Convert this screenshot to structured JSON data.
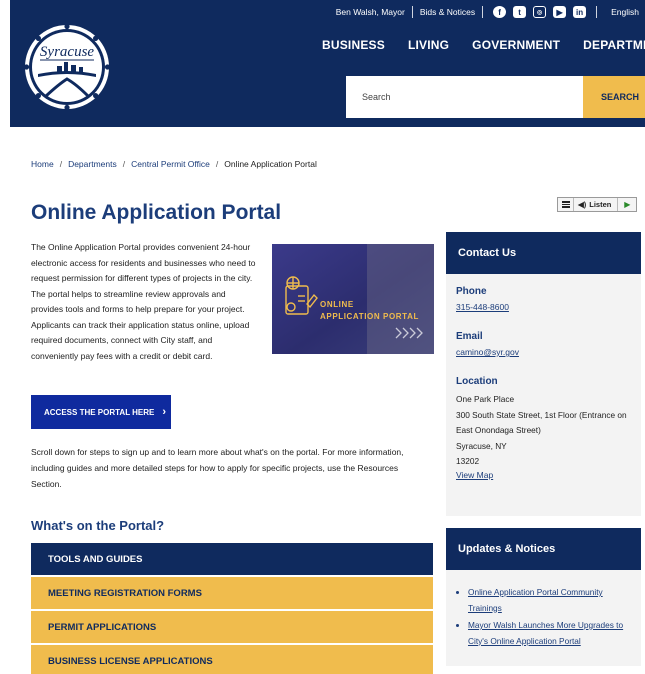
{
  "colors": {
    "navy": "#0f2a5e",
    "gold": "#f0bc4d",
    "link_blue": "#1c3d7a",
    "cta_blue": "#0f2a9e",
    "sidebar_bg": "#f3f3f3"
  },
  "header": {
    "logo_text": "Syracuse",
    "mayor_link": "Ben Walsh, Mayor",
    "bids_link": "Bids & Notices",
    "social_icons": [
      "facebook-icon",
      "twitter-icon",
      "instagram-icon",
      "youtube-icon",
      "linkedin-icon"
    ],
    "language": "English",
    "nav": [
      "BUSINESS",
      "LIVING",
      "GOVERNMENT",
      "DEPARTMENTS"
    ],
    "search_placeholder": "Search",
    "search_button": "SEARCH"
  },
  "breadcrumb": {
    "items": [
      "Home",
      "Departments",
      "Central Permit Office"
    ],
    "current": "Online Application Portal",
    "separator": "/"
  },
  "page": {
    "title": "Online Application Portal",
    "listen_label": "Listen",
    "intro": "The Online Application Portal provides convenient 24-hour electronic access for residents and businesses who need to request permission for different types of projects in the city. The portal helps to streamline review approvals and provides tools and forms to help prepare for your project. Applicants can track their application status online, upload required documents, connect with City staff, and conveniently pay fees with a credit or debit card.",
    "image_caption_line1": "ONLINE",
    "image_caption_line2": "APPLICATION PORTAL",
    "cta_label": "ACCESS THE PORTAL HERE",
    "scroll_text": "Scroll down for steps to sign up and to learn more about what's on the portal. For more information, including guides and more detailed steps for how to apply for specific projects, use the Resources Section.",
    "portal_heading": "What's on the Portal?",
    "accordion": [
      "TOOLS AND GUIDES",
      "MEETING REGISTRATION FORMS",
      "PERMIT APPLICATIONS",
      "BUSINESS LICENSE APPLICATIONS"
    ]
  },
  "contact": {
    "heading": "Contact Us",
    "phone_label": "Phone",
    "phone": "315-448-8600",
    "email_label": "Email",
    "email": "camino@syr.gov",
    "location_label": "Location",
    "address_1": "One Park Place",
    "address_2": "300 South State Street, 1st Floor (Entrance on East Onondaga Street)",
    "address_3": "Syracuse, NY",
    "address_4": "13202",
    "map_link": "View Map"
  },
  "updates": {
    "heading": "Updates & Notices",
    "items": [
      "Online Application Portal Community Trainings",
      "Mayor Walsh Launches More Upgrades to City's Online Application Portal"
    ]
  }
}
